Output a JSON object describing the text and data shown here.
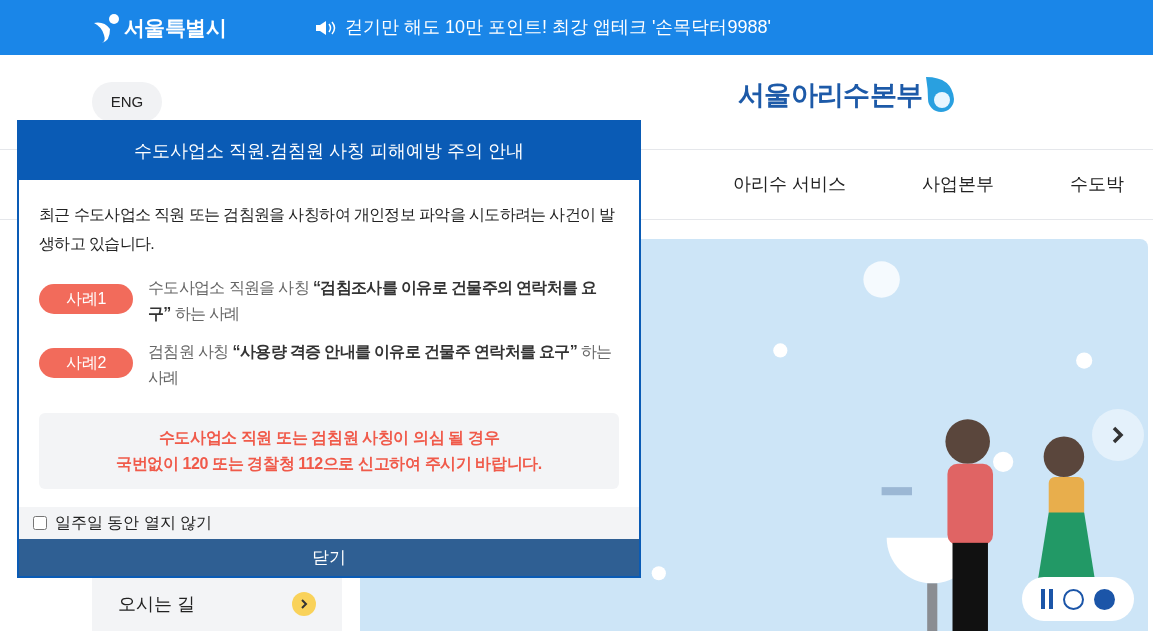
{
  "top_bar": {
    "logo": "서울특별시",
    "notice": "걷기만 해도 10만 포인트! 최강 앱테크 '손목닥터9988'"
  },
  "header": {
    "language_button": "ENG",
    "logo": "서울아리수본부"
  },
  "nav": [
    "아리수 서비스",
    "사업본부",
    "수도박"
  ],
  "sidebar": {
    "items": [
      "오시는 길"
    ]
  },
  "banner": {
    "kind": "picture",
    "slides": [
      {
        "selected": false
      },
      {
        "selected": true
      }
    ]
  },
  "popup": {
    "title": "수도사업소 직원.검침원 사칭 피해예방 주의 안내",
    "intro": "최근 수도사업소 직원 또는 검침원을 사칭하여 개인정보 파악을 시도하려는 사건이 발생하고 있습니다.",
    "cases": [
      {
        "tag": "사례1",
        "text": "수도사업소 직원을 사칭 **“검침조사를 이유로 건물주의 연락처를 요구”** 하는 사례"
      },
      {
        "tag": "사례2",
        "text": "검침원 사칭 **“사용량 격증 안내를 이유로 건물주 연락처를 요구”** 하는 사례"
      }
    ],
    "warning": [
      "수도사업소 직원 또는 검침원 사칭이 의심 될 경우",
      "국번없이 120 또는 경찰청 112으로 신고하여 주시기 바랍니다."
    ],
    "dont_show": {
      "label": "일주일 동안 열지 않기",
      "checked": false
    },
    "close": "닫기"
  }
}
